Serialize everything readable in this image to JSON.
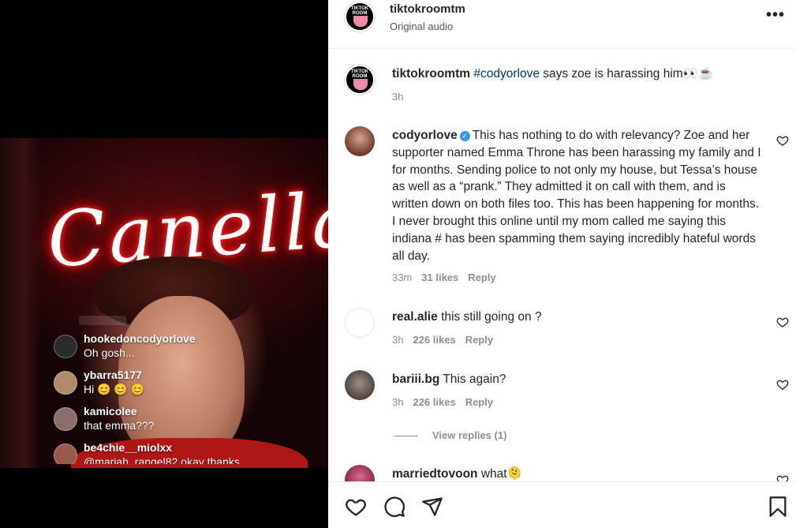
{
  "post": {
    "username": "tiktokroomtm",
    "audio": "Original audio",
    "avatar_logo_text": "TIKTOK ROOM"
  },
  "video_overlay": {
    "neon_sign": "Canella",
    "comments": [
      {
        "user": "hookedoncodyorlove",
        "text": "Oh gosh..."
      },
      {
        "user": "ybarra5177",
        "text": "Hi 😊 😊 😊"
      },
      {
        "user": "kamicolee",
        "text": "that emma???"
      },
      {
        "user": "be4chie__miolxx",
        "text": "@mariah_rangel82 okay thanks"
      }
    ]
  },
  "caption": {
    "user": "tiktokroomtm",
    "hashtag": "#codyorlove",
    "text": " says zoe is harassing him👀☕",
    "time": "3h"
  },
  "comments": [
    {
      "user": "codyorlove",
      "verified": true,
      "text": "This has nothing to do with relevancy? Zoe and her supporter named Emma Throne has been harassing my family and I for months. Sending police to not only my house, but Tessa’s house as well as a “prank.” They admitted it on call with them, and is written down on both files too. This has been happening for months. I never brought this online until my mom called me saying this indiana # has been spamming them saying incredibly hateful words all day.",
      "time": "33m",
      "likes": "31 likes",
      "reply": "Reply"
    },
    {
      "user": "real.alie",
      "text": "this still going on ?",
      "time": "3h",
      "likes": "226 likes",
      "reply": "Reply"
    },
    {
      "user": "bariii.bg",
      "text": "This again?",
      "time": "3h",
      "likes": "226 likes",
      "reply": "Reply"
    },
    {
      "user": "marriedtovoon",
      "text": "what🫠"
    }
  ],
  "view_replies": "View replies (1)",
  "colors": {
    "accent_link": "#00376b",
    "verified": "#3897f0",
    "meta_gray": "#8e8e8e"
  },
  "icons": [
    "more-icon",
    "heart-icon",
    "comment-icon",
    "share-icon",
    "bookmark-icon"
  ]
}
